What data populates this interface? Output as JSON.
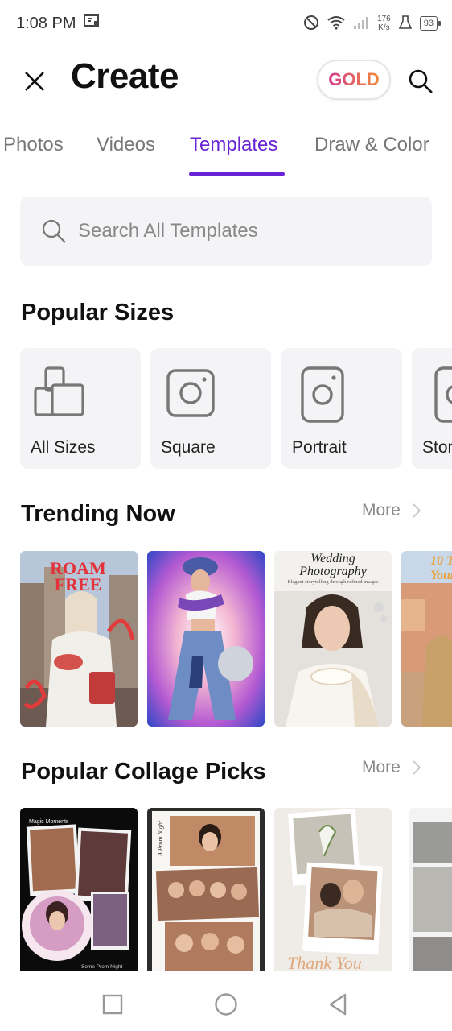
{
  "status_bar": {
    "time": "1:08 PM",
    "net_speed_value": "176",
    "net_speed_unit": "K/s",
    "battery": "93"
  },
  "header": {
    "title": "Create",
    "gold_label": "GOLD"
  },
  "tabs": [
    {
      "label": "Photos"
    },
    {
      "label": "Videos"
    },
    {
      "label": "Templates"
    },
    {
      "label": "Draw & Color"
    }
  ],
  "active_tab": "Templates",
  "search": {
    "placeholder": "Search All Templates"
  },
  "popular_sizes": {
    "title": "Popular Sizes",
    "items": [
      {
        "label": "All Sizes",
        "icon": "all-sizes-icon"
      },
      {
        "label": "Square",
        "icon": "square-icon"
      },
      {
        "label": "Portrait",
        "icon": "portrait-icon"
      },
      {
        "label": "Stor",
        "icon": "story-icon"
      }
    ]
  },
  "trending": {
    "title": "Trending Now",
    "more_label": "More",
    "items": [
      {
        "title_line1": "ROAM",
        "title_line2": "FREE"
      },
      {
        "caption": ""
      },
      {
        "title_line1": "Wedding",
        "title_line2": "Photography",
        "subtitle": "Elegant storytelling through refined images"
      },
      {
        "title_line1": "10 T",
        "title_line2": "Your"
      }
    ]
  },
  "collage": {
    "title": "Popular Collage Picks",
    "more_label": "More",
    "items": [
      {
        "top_text": "Magic Moments",
        "bottom_text": "Some Prom Night"
      },
      {
        "side_text": "A Prom Night"
      },
      {
        "bottom_text": "Thank You"
      },
      {}
    ]
  },
  "colors": {
    "accent": "#6a22d6",
    "gold_start": "#d33a8c",
    "gold_end": "#f08a3a",
    "card_bg": "#f4f4f6"
  }
}
